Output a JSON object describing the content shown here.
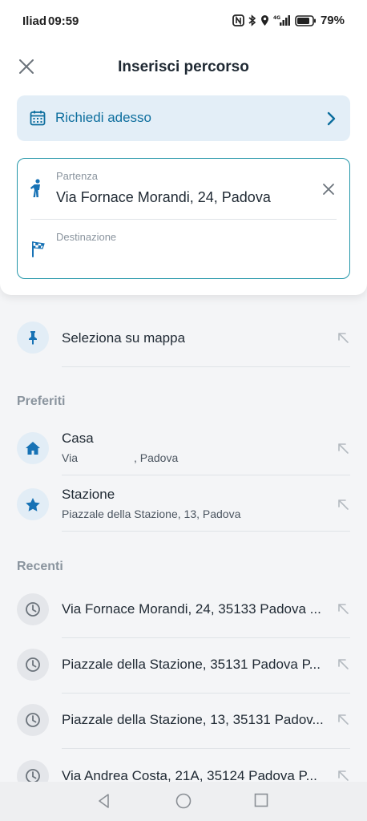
{
  "status": {
    "carrier": "Iliad",
    "time": "09:59",
    "network": "4G",
    "battery": "79%"
  },
  "header": {
    "title": "Inserisci percorso",
    "close_icon": "close-icon"
  },
  "request": {
    "label": "Richiedi adesso",
    "icon": "calendar-icon"
  },
  "route": {
    "from_label": "Partenza",
    "from_value": "Via Fornace Morandi, 24, Padova",
    "to_label": "Destinazione",
    "to_value": ""
  },
  "map_option": {
    "label": "Seleziona su mappa"
  },
  "favorites": {
    "title": "Preferiti",
    "items": [
      {
        "title": "Casa",
        "subtitle": "Via                  , Padova",
        "icon": "home-icon"
      },
      {
        "title": "Stazione",
        "subtitle": "Piazzale della Stazione, 13, Padova",
        "icon": "star-icon"
      }
    ]
  },
  "recents": {
    "title": "Recenti",
    "items": [
      {
        "title": "Via Fornace Morandi, 24, 35133 Padova ..."
      },
      {
        "title": "Piazzale della Stazione, 35131 Padova P..."
      },
      {
        "title": "Piazzale della Stazione, 13, 35131 Padov..."
      },
      {
        "title": "Via Andrea Costa, 21A, 35124 Padova P..."
      }
    ]
  },
  "colors": {
    "accent": "#0d6e9e",
    "icon_blue": "#1772b5",
    "border_teal": "#2496a9"
  }
}
